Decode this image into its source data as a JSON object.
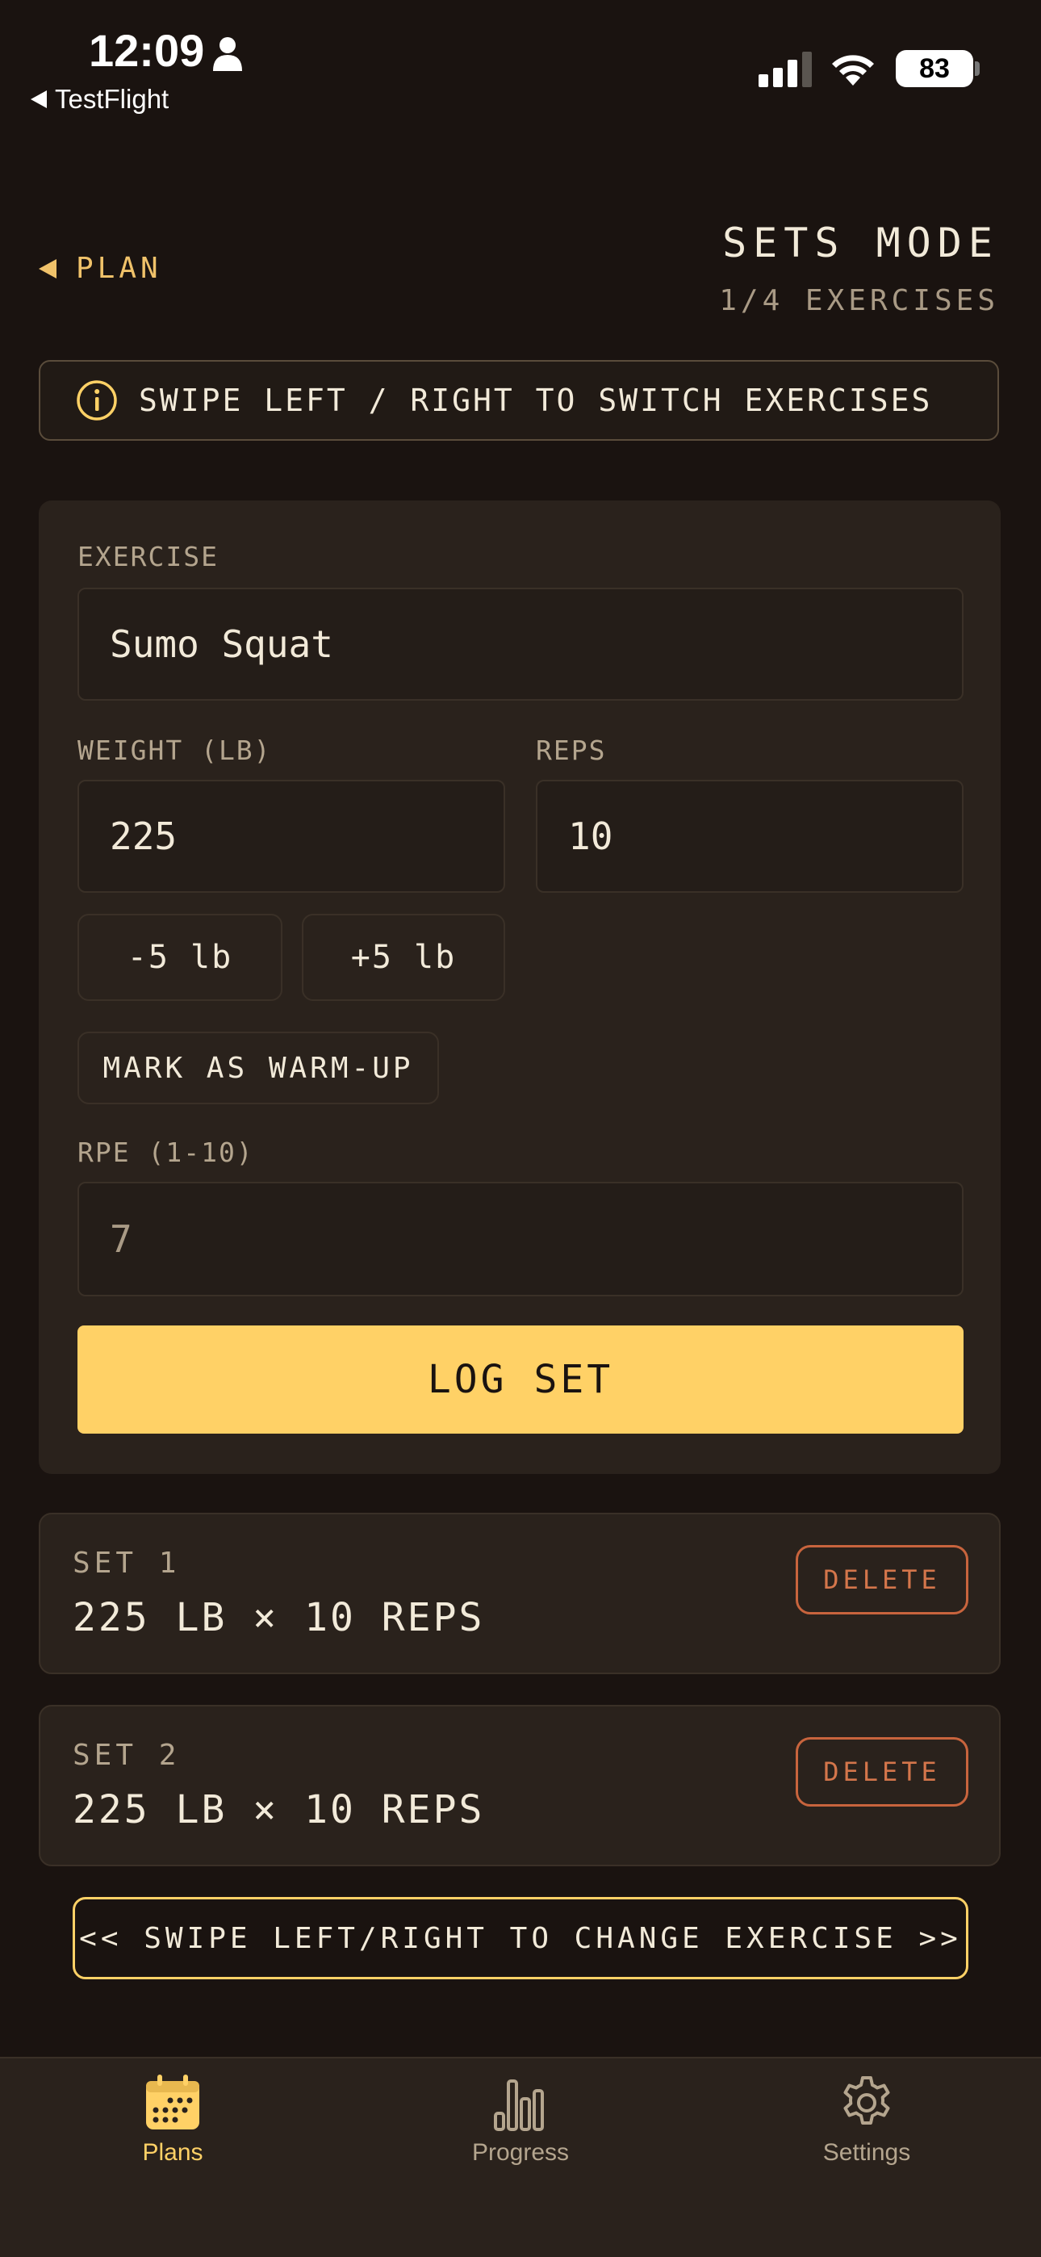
{
  "status_bar": {
    "time": "12:09",
    "back_app": "TestFlight",
    "battery": "83"
  },
  "header": {
    "back_label": "PLAN",
    "title": "SETS MODE",
    "subtitle": "1/4 EXERCISES"
  },
  "banner": {
    "text": "SWIPE LEFT / RIGHT TO SWITCH EXERCISES"
  },
  "form": {
    "exercise_label": "EXERCISE",
    "exercise_value": "Sumo Squat",
    "weight_label": "WEIGHT (LB)",
    "weight_value": "225",
    "reps_label": "REPS",
    "reps_value": "10",
    "minus_label": "-5 lb",
    "plus_label": "+5 lb",
    "warmup_label": "MARK AS WARM-UP",
    "rpe_label": "RPE (1-10)",
    "rpe_value": "7",
    "log_label": "LOG SET"
  },
  "sets": [
    {
      "label": "SET 1",
      "detail": "225 LB × 10 REPS",
      "delete": "DELETE"
    },
    {
      "label": "SET 2",
      "detail": "225 LB × 10 REPS",
      "delete": "DELETE"
    }
  ],
  "swipe_button": "<< SWIPE LEFT/RIGHT TO CHANGE EXERCISE >>",
  "tabs": [
    {
      "label": "Plans",
      "icon": "calendar-icon",
      "active": true
    },
    {
      "label": "Progress",
      "icon": "bar-chart-icon",
      "active": false
    },
    {
      "label": "Settings",
      "icon": "gear-icon",
      "active": false
    }
  ],
  "colors": {
    "background": "#1a1310",
    "card": "#2a221c",
    "accent": "#ffd166",
    "danger": "#d4764b"
  }
}
